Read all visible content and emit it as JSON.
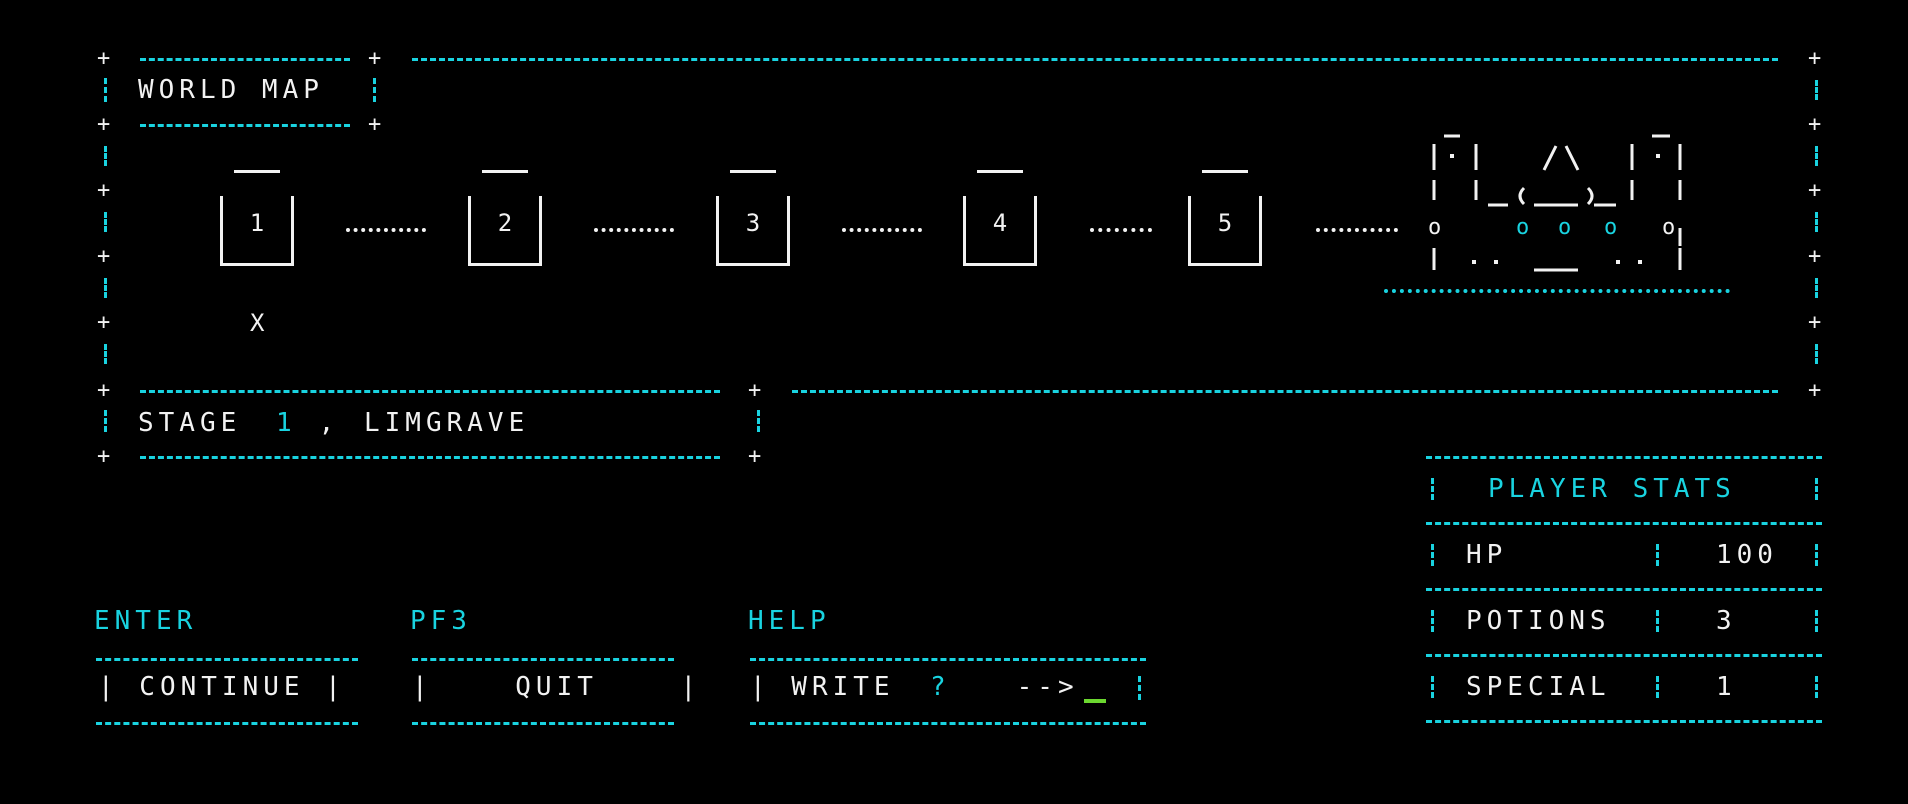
{
  "world_map": {
    "title": "WORLD MAP",
    "stages": [
      "1",
      "2",
      "3",
      "4",
      "5"
    ],
    "player_marker": "X"
  },
  "location": {
    "prefix": "STAGE ",
    "stage_number": "1",
    "separator": " , ",
    "name": "LIMGRAVE"
  },
  "keys": [
    {
      "key": "ENTER",
      "action": "| CONTINUE |"
    },
    {
      "key": "PF3",
      "action": "|    QUIT    |"
    },
    {
      "key": "HELP",
      "action_prefix": "| WRITE ",
      "action_symbol": "?",
      "action_suffix": " -->"
    }
  ],
  "player_stats": {
    "title": "PLAYER STATS",
    "rows": [
      {
        "label": "HP",
        "value": "100"
      },
      {
        "label": "POTIONS",
        "value": "3"
      },
      {
        "label": "SPECIAL",
        "value": "1"
      }
    ]
  },
  "colors": {
    "frame": "#19d3e0",
    "text": "#f2f2f2",
    "cursor": "#6cd830",
    "background": "#000000"
  }
}
